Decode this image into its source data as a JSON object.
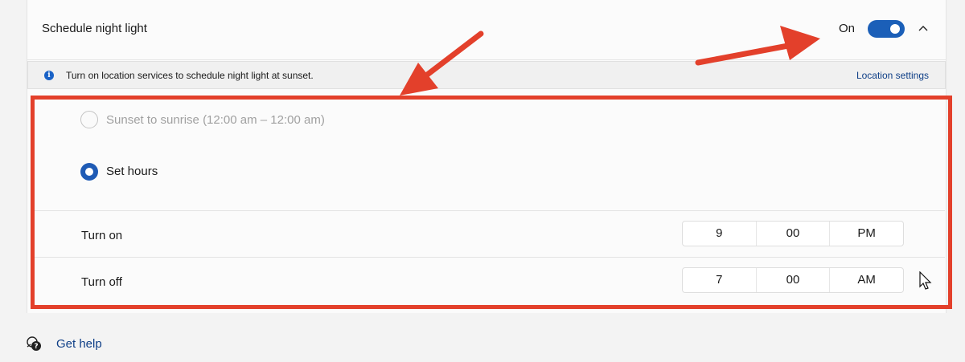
{
  "header": {
    "title": "Schedule night light",
    "toggle_state": "On"
  },
  "info_bar": {
    "message": "Turn on location services to schedule night light at sunset.",
    "link": "Location settings"
  },
  "schedule_options": [
    {
      "label": "Sunset to sunrise (12:00 am – 12:00 am)",
      "selected": false,
      "disabled": true
    },
    {
      "label": "Set hours",
      "selected": true,
      "disabled": false
    }
  ],
  "turn_on": {
    "label": "Turn on",
    "hour": "9",
    "minute": "00",
    "period": "PM"
  },
  "turn_off": {
    "label": "Turn off",
    "hour": "7",
    "minute": "00",
    "period": "AM"
  },
  "footer": {
    "help_link": "Get help"
  },
  "colors": {
    "accent": "#1b5fb8",
    "annotation_red": "#e3402b",
    "link": "#0f3f87"
  },
  "icons": [
    "info-icon",
    "chevron-up-icon",
    "get-help-icon",
    "mouse-cursor-icon",
    "annotation-arrow-icon"
  ]
}
